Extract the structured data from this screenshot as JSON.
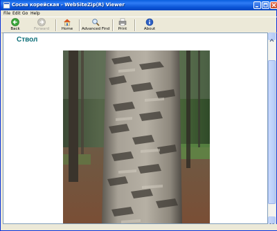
{
  "window": {
    "title": "Сосна корейская - WebSiteZip(R) Viewer"
  },
  "menu": {
    "items": [
      "File",
      "Edit",
      "Go",
      "Help"
    ]
  },
  "toolbar": {
    "back": "Back",
    "forward": "Forward",
    "home": "Home",
    "advanced_find": "Advanced Find",
    "print": "Print",
    "about": "About"
  },
  "page": {
    "heading": "Ствол"
  },
  "colors": {
    "title_bar": "#0A5FDE",
    "heading": "#0B6E78",
    "chrome": "#ECE9D8"
  },
  "icons": {
    "back": "green-back-arrow-icon",
    "forward": "grey-forward-arrow-icon",
    "home": "house-icon",
    "advanced_find": "magnifier-icon",
    "print": "printer-icon",
    "about": "info-icon"
  }
}
